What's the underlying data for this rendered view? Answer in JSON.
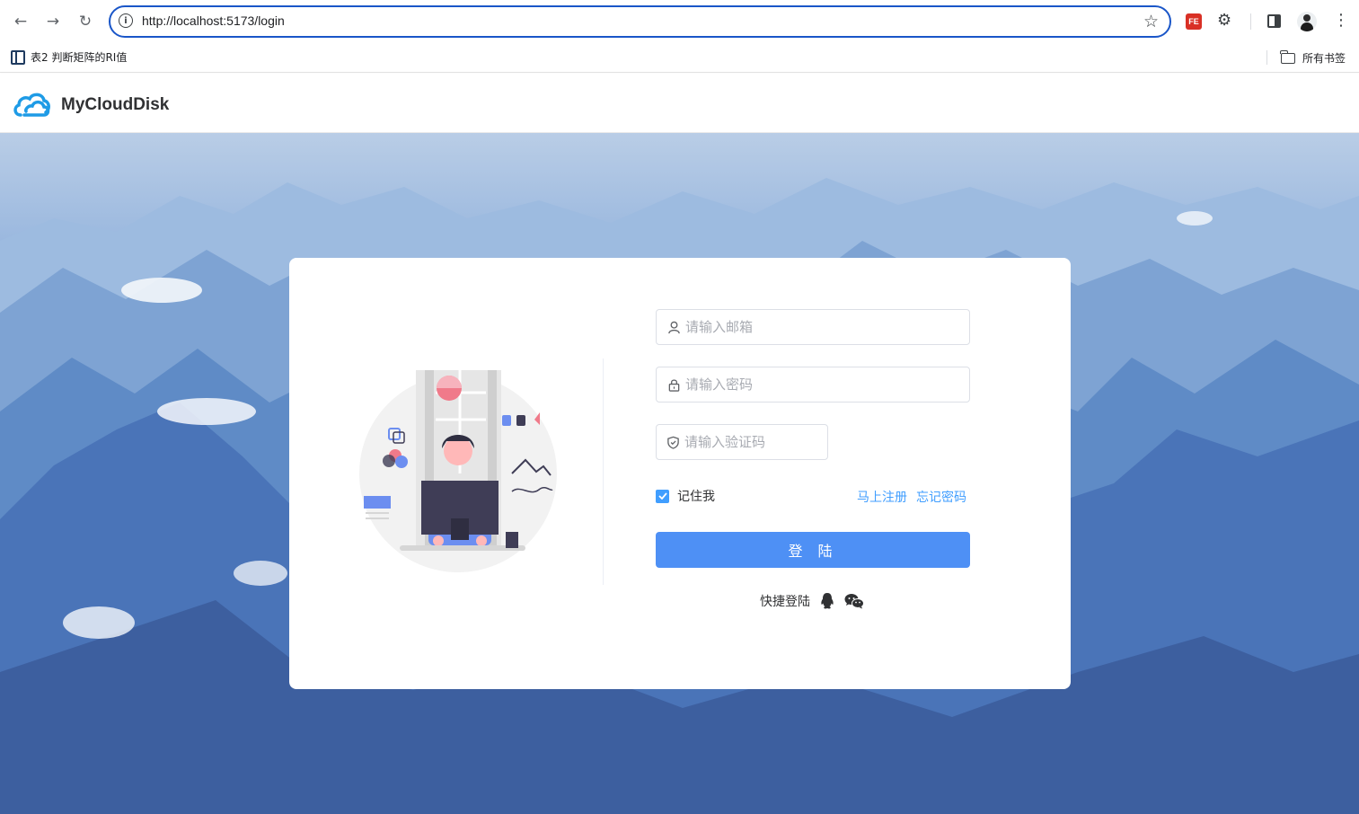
{
  "browser": {
    "url": "http://localhost:5173/login",
    "info_icon": "info-icon",
    "extension_badge": "FE",
    "bookmark_item": "表2 判断矩阵的RI值",
    "all_bookmarks": "所有书签"
  },
  "app": {
    "title": "MyCloudDisk",
    "accent_color": "#4e90f5"
  },
  "login": {
    "email_placeholder": "请输入邮箱",
    "password_placeholder": "请输入密码",
    "captcha_placeholder": "请输入验证码",
    "remember_label": "记住我",
    "remember_checked": true,
    "register_link": "马上注册",
    "forgot_link": "忘记密码",
    "submit_label": "登 陆",
    "quick_login_label": "快捷登陆"
  }
}
